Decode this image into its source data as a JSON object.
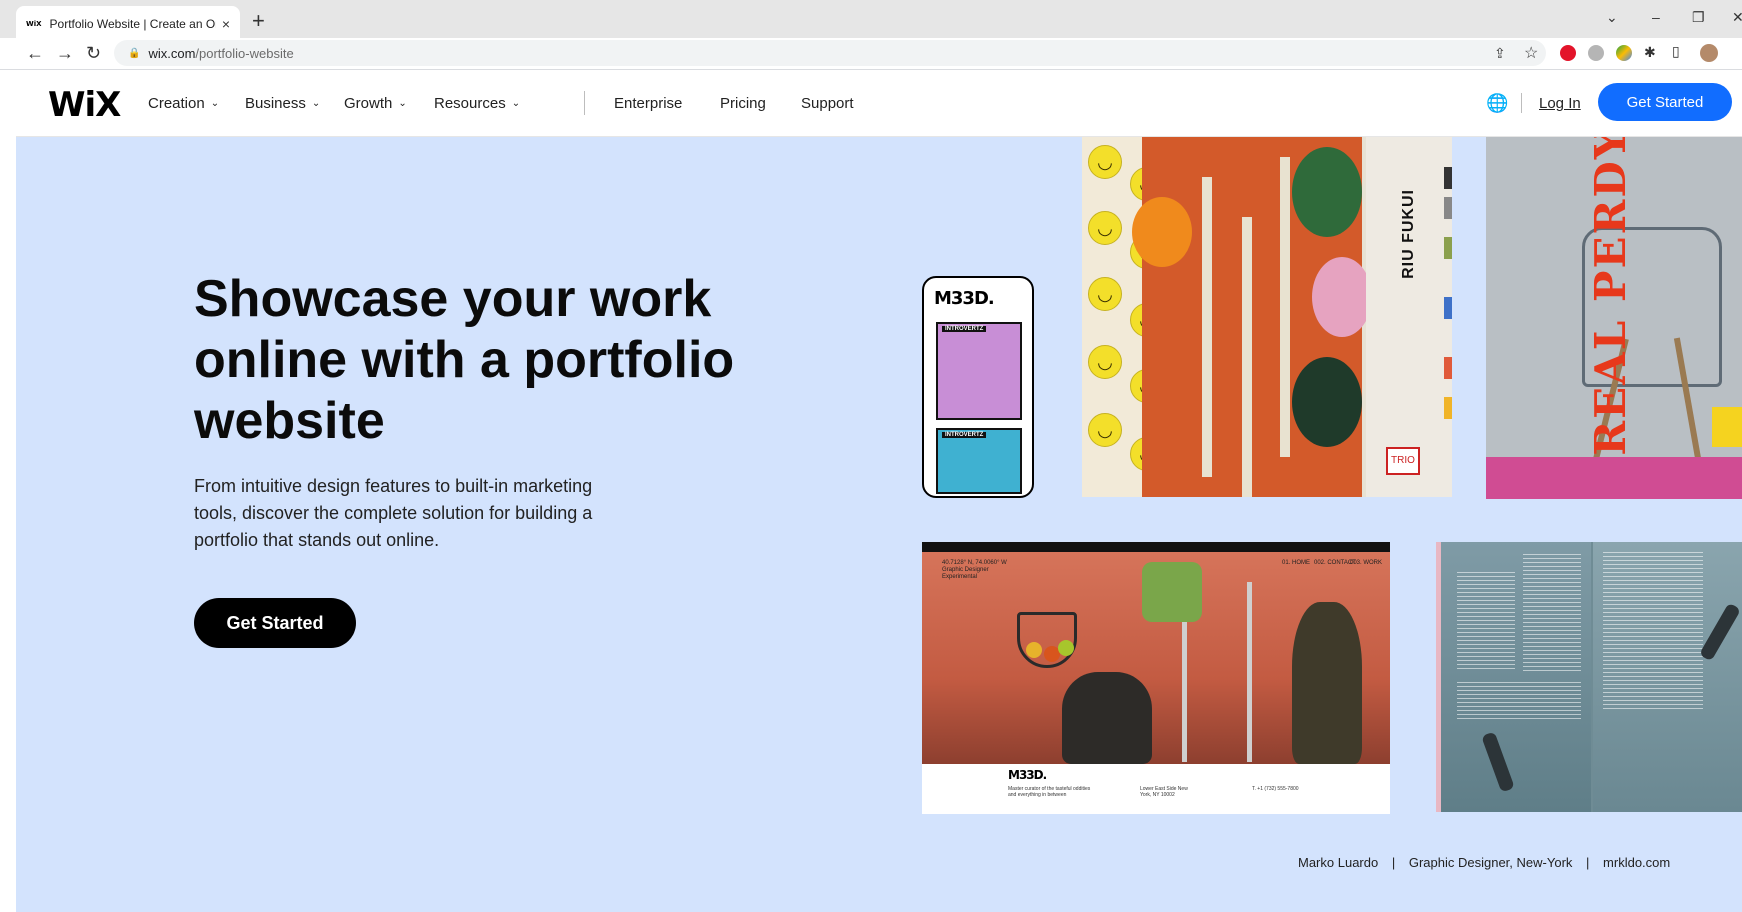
{
  "browser": {
    "tab_title": "Portfolio Website | Create an Onl",
    "tab_favicon": "WiX",
    "new_tab": "+",
    "tab_close": "×",
    "url_host": "wix.com",
    "url_path": "/portfolio-website",
    "nav_back": "←",
    "nav_forward": "→",
    "nav_reload": "↻",
    "lock_icon": "🔒",
    "win_dropdown": "⌄",
    "win_min": "–",
    "win_restore": "❐",
    "win_close": "✕",
    "share_icon": "⇪",
    "star_icon": "☆",
    "ext_icon": "✱",
    "panel_icon": "▯"
  },
  "header": {
    "logo": "WiX",
    "menu": [
      {
        "label": "Creation",
        "chevron": "⌄"
      },
      {
        "label": "Business",
        "chevron": "⌄"
      },
      {
        "label": "Growth",
        "chevron": "⌄"
      },
      {
        "label": "Resources",
        "chevron": "⌄"
      }
    ],
    "links": [
      "Enterprise",
      "Pricing",
      "Support"
    ],
    "globe": "🌐",
    "login": "Log In",
    "cta": "Get Started",
    "cta_color": "#116dff"
  },
  "hero": {
    "headline": "Showcase your work online with a portfolio website",
    "subtext": "From intuitive design features to built-in marketing tools, discover the complete solution for building a portfolio that stands out online.",
    "cta": "Get Started",
    "background": "#d3e3fd",
    "credit": {
      "name": "Marko Luardo",
      "role": "Graphic Designer, New-York",
      "site": "mrkldo.com",
      "separator": "|"
    }
  },
  "gallery": {
    "phone_brand": "M33D.",
    "phone_labels": [
      "INTROVERTZ",
      "INTROVERTZ"
    ],
    "poster_name": "RIU FUKUI",
    "poster_tag": "TRIO",
    "chair_title": "REAL PERDY",
    "card4_brand": "M33D.",
    "card4_footer": [
      "Master curator of the tasteful oddities and everything in between",
      "Lower East Side New York, NY 10002",
      "T. +1 (732) 555-7800"
    ],
    "card4_nav": [
      "01. HOME",
      "002. CONTACT",
      "003. WORK"
    ],
    "card4_caption": "40.7128° N, 74.0060° W Graphic Designer Experimental"
  }
}
